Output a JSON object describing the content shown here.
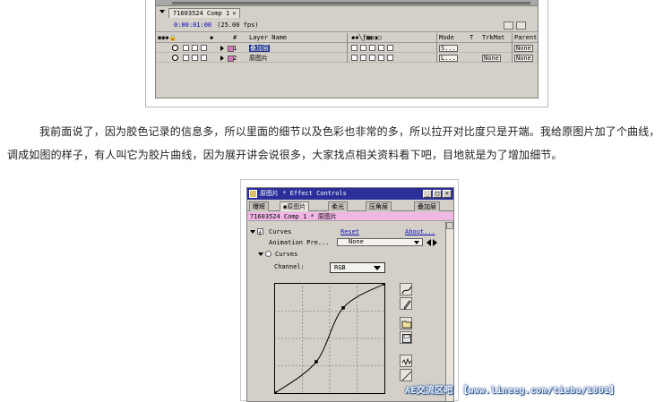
{
  "timeline": {
    "comp_tab": "71603524 Comp 1",
    "tab_close": "×",
    "timecode": "0:00:01:00",
    "fps": "(25.00 fps)",
    "headers": {
      "switches": "◉◉◆🔒",
      "label": "◆",
      "num": "#",
      "layer_name": "Layer Name",
      "fx_switches": "◆✱╲ƒ▩◐◑◯",
      "mode": "Mode",
      "t": "T",
      "trkmat": "TrkMat",
      "parent": "Parent"
    },
    "layers": [
      {
        "num": "1",
        "name": "叠加层",
        "mode": "S...",
        "trkmat": "",
        "parent": "None",
        "selected": true
      },
      {
        "num": "2",
        "name": "原图片",
        "mode": "L...",
        "trkmat": "None",
        "parent": "None",
        "selected": false
      }
    ]
  },
  "paragraph": "我前面说了，因为胶色记录的信息多，所以里面的细节以及色彩也非常的多，所以拉开对比度只是开端。我给原图片加了个曲线，调成如图的样子，有人叫它为胶片曲线，因为展开讲会说很多，大家找点相关资料看下吧，目地就是为了增加细节。",
  "effect_controls": {
    "window_title": "原图片 * Effect Controls",
    "window_buttons": [
      "_",
      "□",
      "×"
    ],
    "tabs": [
      "曝辉",
      "原图片",
      "柔光",
      "压角层",
      "叠加层"
    ],
    "active_tab": "原图片",
    "comp_path": "71603524 Comp 1 * 原图片",
    "effect_name": "Curves",
    "fx_badge": "f",
    "reset_label": "Reset",
    "about_label": "About...",
    "animation_presets_label": "Animation Pre...",
    "animation_presets_value": "None",
    "curves_group_label": "Curves",
    "channel_label": "Channel:",
    "channel_value": "RGB"
  },
  "curve": {
    "points": [
      [
        0,
        0
      ],
      [
        96,
        73
      ],
      [
        159,
        199
      ],
      [
        255,
        255
      ]
    ],
    "domain": [
      0,
      255
    ],
    "grid_divisions": 4
  },
  "watermark": "AE交流区吧 【www.lineeg.com/tieba/1801】",
  "colors": {
    "panel_gray": "#d4d0c8",
    "title_blue": "#2b2f9a",
    "comp_bar_pink": "#f0b6e4",
    "link_blue": "#1010c0",
    "selected_row": "#1a2f8a"
  }
}
